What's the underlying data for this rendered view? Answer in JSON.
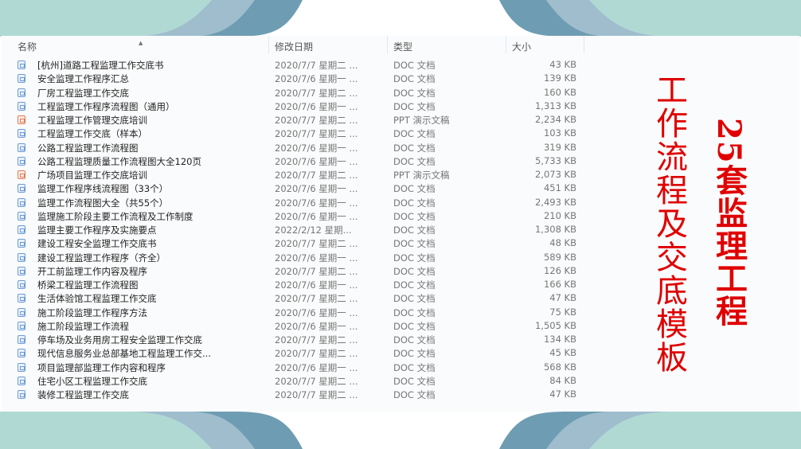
{
  "columns": {
    "name": "名称",
    "date": "修改日期",
    "type": "类型",
    "size": "大小"
  },
  "files": [
    {
      "name": "[杭州]道路工程监理工作交底书",
      "date": "2020/7/7 星期二 ...",
      "type": "DOC 文档",
      "size": "43 KB",
      "kind": "doc"
    },
    {
      "name": "安全监理工作程序汇总",
      "date": "2020/7/6 星期一 ...",
      "type": "DOC 文档",
      "size": "139 KB",
      "kind": "doc"
    },
    {
      "name": "厂房工程监理工作交底",
      "date": "2020/7/7 星期二 ...",
      "type": "DOC 文档",
      "size": "160 KB",
      "kind": "doc"
    },
    {
      "name": "工程监理工作程序流程图（通用）",
      "date": "2020/7/6 星期一 ...",
      "type": "DOC 文档",
      "size": "1,313 KB",
      "kind": "doc"
    },
    {
      "name": "工程监理工作管理交底培训",
      "date": "2020/7/7 星期二 ...",
      "type": "PPT 演示文稿",
      "size": "2,234 KB",
      "kind": "ppt"
    },
    {
      "name": "工程监理工作交底（样本）",
      "date": "2020/7/7 星期二 ...",
      "type": "DOC 文档",
      "size": "103 KB",
      "kind": "doc"
    },
    {
      "name": "公路工程监理工作流程图",
      "date": "2020/7/6 星期一 ...",
      "type": "DOC 文档",
      "size": "319 KB",
      "kind": "doc"
    },
    {
      "name": "公路工程监理质量工作流程图大全120页",
      "date": "2020/7/6 星期一 ...",
      "type": "DOC 文档",
      "size": "5,733 KB",
      "kind": "doc"
    },
    {
      "name": "广场项目监理工作交底培训",
      "date": "2020/7/7 星期二 ...",
      "type": "PPT 演示文稿",
      "size": "2,073 KB",
      "kind": "ppt"
    },
    {
      "name": "监理工作程序线流程图（33个）",
      "date": "2020/7/6 星期一 ...",
      "type": "DOC 文档",
      "size": "451 KB",
      "kind": "doc"
    },
    {
      "name": "监理工作流程图大全（共55个）",
      "date": "2020/7/6 星期一 ...",
      "type": "DOC 文档",
      "size": "2,493 KB",
      "kind": "doc"
    },
    {
      "name": "监理施工阶段主要工作流程及工作制度",
      "date": "2020/7/6 星期一 ...",
      "type": "DOC 文档",
      "size": "210 KB",
      "kind": "doc"
    },
    {
      "name": "监理主要工作程序及实施要点",
      "date": "2022/2/12 星期...",
      "type": "DOC 文档",
      "size": "1,308 KB",
      "kind": "doc"
    },
    {
      "name": "建设工程安全监理工作交底书",
      "date": "2020/7/7 星期二 ...",
      "type": "DOC 文档",
      "size": "48 KB",
      "kind": "doc"
    },
    {
      "name": "建设工程监理工作程序（齐全）",
      "date": "2020/7/6 星期一 ...",
      "type": "DOC 文档",
      "size": "589 KB",
      "kind": "doc"
    },
    {
      "name": "开工前监理工作内容及程序",
      "date": "2020/7/7 星期二 ...",
      "type": "DOC 文档",
      "size": "126 KB",
      "kind": "doc"
    },
    {
      "name": "桥梁工程监理工作流程图",
      "date": "2020/7/6 星期一 ...",
      "type": "DOC 文档",
      "size": "166 KB",
      "kind": "doc"
    },
    {
      "name": "生活体验馆工程监理工作交底",
      "date": "2020/7/7 星期二 ...",
      "type": "DOC 文档",
      "size": "47 KB",
      "kind": "doc"
    },
    {
      "name": "施工阶段监理工作程序方法",
      "date": "2020/7/6 星期一 ...",
      "type": "DOC 文档",
      "size": "75 KB",
      "kind": "doc"
    },
    {
      "name": "施工阶段监理工作流程",
      "date": "2020/7/6 星期一 ...",
      "type": "DOC 文档",
      "size": "1,505 KB",
      "kind": "doc"
    },
    {
      "name": "停车场及业务用房工程安全监理工作交底",
      "date": "2020/7/7 星期二 ...",
      "type": "DOC 文档",
      "size": "134 KB",
      "kind": "doc"
    },
    {
      "name": "现代信息服务业总部基地工程监理工作交...",
      "date": "2020/7/7 星期二 ...",
      "type": "DOC 文档",
      "size": "45 KB",
      "kind": "doc"
    },
    {
      "name": "项目监理部监理工作内容和程序",
      "date": "2020/7/6 星期一 ...",
      "type": "DOC 文档",
      "size": "568 KB",
      "kind": "doc"
    },
    {
      "name": "住宅小区工程监理工作交底",
      "date": "2020/7/7 星期二 ...",
      "type": "DOC 文档",
      "size": "84 KB",
      "kind": "doc"
    },
    {
      "name": "装修工程监理工作交底",
      "date": "2020/7/7 星期二 ...",
      "type": "DOC 文档",
      "size": "47 KB",
      "kind": "doc"
    }
  ],
  "overlay": {
    "title": "工作流程及交底模板",
    "subtitle": "25套监理工程"
  },
  "colors": {
    "teal": "#b0d9d4",
    "light_blue": "#9fbdcd",
    "dark_blue": "#6e9db3",
    "red": "#e00000"
  }
}
